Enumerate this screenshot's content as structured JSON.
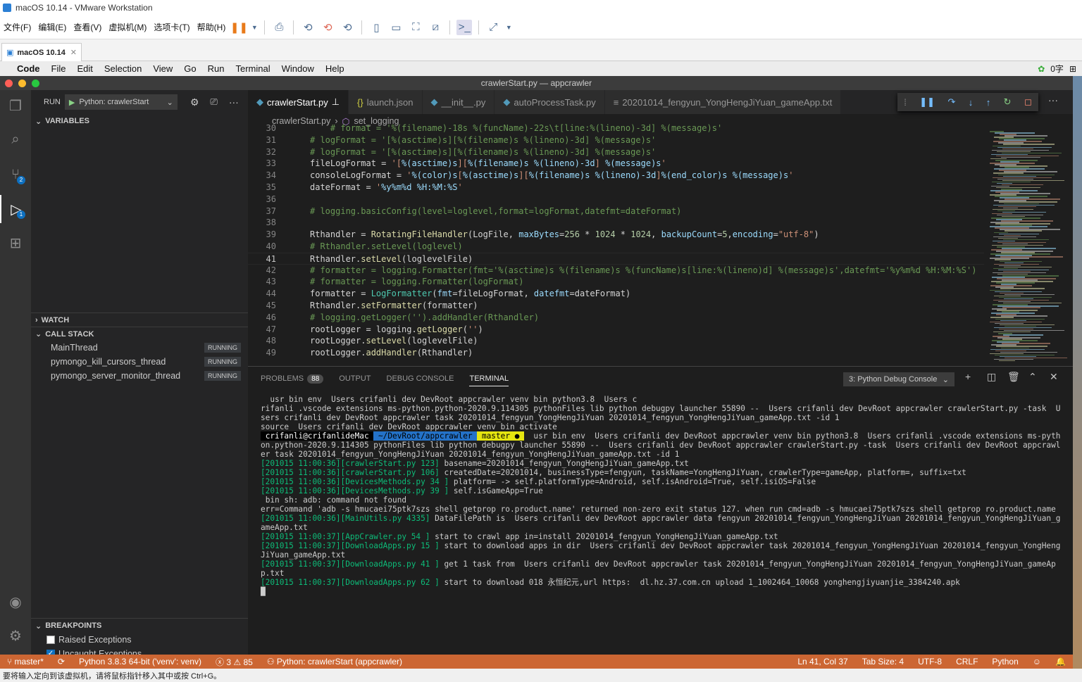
{
  "vm": {
    "title": "macOS 10.14 - VMware Workstation",
    "menu": [
      "文件(F)",
      "编辑(E)",
      "查看(V)",
      "虚拟机(M)",
      "选项卡(T)",
      "帮助(H)"
    ],
    "tab": "macOS 10.14",
    "status_hint": "要将输入定向到该虚拟机，请将鼠标指针移入其中或按 Ctrl+G。"
  },
  "mac": {
    "menu": [
      "Code",
      "File",
      "Edit",
      "Selection",
      "View",
      "Go",
      "Run",
      "Terminal",
      "Window",
      "Help"
    ],
    "right_text": "0字"
  },
  "window_title": "crawlerStart.py — appcrawler",
  "activity_badges": {
    "scm": "2",
    "debug": "1"
  },
  "sidebar": {
    "run_label": "RUN",
    "config": "Python: crawlerStart",
    "variables": "VARIABLES",
    "watch": "WATCH",
    "call_stack": "CALL STACK",
    "threads": [
      {
        "name": "MainThread",
        "state": "RUNNING"
      },
      {
        "name": "pymongo_kill_cursors_thread",
        "state": "RUNNING"
      },
      {
        "name": "pymongo_server_monitor_thread",
        "state": "RUNNING"
      }
    ],
    "breakpoints": "BREAKPOINTS",
    "bp_items": [
      {
        "label": "Raised Exceptions",
        "checked": false
      },
      {
        "label": "Uncaught Exceptions",
        "checked": true
      }
    ]
  },
  "tabs": [
    {
      "label": "crawlerStart.py",
      "icon": "python-icon",
      "active": true
    },
    {
      "label": "launch.json",
      "icon": "json-icon",
      "active": false
    },
    {
      "label": "__init__.py",
      "icon": "python-icon",
      "active": false
    },
    {
      "label": "autoProcessTask.py",
      "icon": "python-icon",
      "active": false
    },
    {
      "label": "20201014_fengyun_YongHengJiYuan_gameApp.txt",
      "icon": "text-file-icon",
      "active": false
    }
  ],
  "breadcrumb": [
    "crawlerStart.py",
    "set_logging"
  ],
  "code_lines": [
    {
      "no": "30",
      "html": "<span class='cmt'>    # format = '%(filename)-18s %(funcName)-22s\\t[line:%(lineno)-3d] %(message)s'</span>"
    },
    {
      "no": "31",
      "html": "<span class='cmt'># logFormat = '[%(asctime)s][%(filename)s %(lineno)-3d] %(message)s'</span>"
    },
    {
      "no": "32",
      "html": "<span class='cmt'># logFormat = '[%(asctime)s][%(filename)s %(lineno)-3d] %(message)s'</span>"
    },
    {
      "no": "33",
      "html": "fileLogFormat = <span class='str'>'[</span><span class='kw'>%(asctime)s</span><span class='str'>][</span><span class='kw'>%(filename)s %(lineno)-3d</span><span class='str'>] </span><span class='kw'>%(message)s</span><span class='str'>'</span>"
    },
    {
      "no": "34",
      "html": "consoleLogFormat = <span class='str'>'</span><span class='kw'>%(color)s</span><span class='str'>[</span><span class='kw'>%(asctime)s</span><span class='str'>][</span><span class='kw'>%(filename)s %(lineno)-3d</span><span class='str'>]</span><span class='kw'>%(end_color)s %(message)s</span><span class='str'>'</span>"
    },
    {
      "no": "35",
      "html": "dateFormat = <span class='str'>'</span><span class='kw'>%y%m%d %H:%M:%S</span><span class='str'>'</span>"
    },
    {
      "no": "36",
      "html": ""
    },
    {
      "no": "37",
      "html": "<span class='cmt'># logging.basicConfig(level=loglevel,format=logFormat,datefmt=dateFormat)</span>"
    },
    {
      "no": "38",
      "html": ""
    },
    {
      "no": "39",
      "html": "Rthandler = <span class='fn'>RotatingFileHandler</span>(LogFile, <span class='kw'>maxBytes</span>=<span class='num'>256</span> * <span class='num'>1024</span> * <span class='num'>1024</span>, <span class='kw'>backupCount</span>=<span class='num'>5</span>,<span class='kw'>encoding</span>=<span class='str'>\"utf-8\"</span>)"
    },
    {
      "no": "40",
      "html": "<span class='cmt'># Rthandler.setLevel(loglevel)</span>"
    },
    {
      "no": "41",
      "html": "Rthandler.<span class='fn'>setLevel</span>(loglevelFile)",
      "cur": true
    },
    {
      "no": "42",
      "html": "<span class='cmt'># formatter = logging.Formatter(fmt='%(asctime)s %(filename)s %(funcName)s[line:%(lineno)d] %(message)s',datefmt='%y%m%d %H:%M:%S')</span>"
    },
    {
      "no": "43",
      "html": "<span class='cmt'># formatter = logging.Formatter(logFormat)</span>"
    },
    {
      "no": "44",
      "html": "formatter = <span class='cls'>LogFormatter</span>(<span class='kw'>fmt</span>=fileLogFormat, <span class='kw'>datefmt</span>=dateFormat)"
    },
    {
      "no": "45",
      "html": "Rthandler.<span class='fn'>setFormatter</span>(formatter)"
    },
    {
      "no": "46",
      "html": "<span class='cmt'># logging.getLogger('').addHandler(Rthandler)</span>"
    },
    {
      "no": "47",
      "html": "rootLogger = logging.<span class='fn'>getLogger</span>(<span class='str'>''</span>)"
    },
    {
      "no": "48",
      "html": "rootLogger.<span class='fn'>setLevel</span>(loglevelFile)"
    },
    {
      "no": "49",
      "html": "rootLogger.<span class='fn'>addHandler</span>(Rthandler)"
    },
    {
      "no": "50",
      "html": ""
    }
  ],
  "panel": {
    "tabs": [
      "PROBLEMS",
      "OUTPUT",
      "DEBUG CONSOLE",
      "TERMINAL"
    ],
    "problems_count": "88",
    "active": "TERMINAL",
    "terminal_select": "3: Python Debug Console"
  },
  "terminal_html": "  usr bin env  Users crifanli dev DevRoot appcrawler venv bin python3.8  Users c\nrifanli .vscode extensions ms-python.python-2020.9.114305 pythonFiles lib python debugpy launcher 55890 --  Users crifanli dev DevRoot appcrawler crawlerStart.py -task  Users crifanli dev DevRoot appcrawler task 20201014_fengyun_YongHengJiYuan 20201014_fengyun_YongHengJiYuan_gameApp.txt -id 1\nsource  Users crifanli dev DevRoot appcrawler venv bin activate\n<span class='pbg'> crifanli@crifanlideMac </span><span class='pblue'> ~/DevRoot/appcrawler </span><span class='pyel'> master ● </span>  usr bin env  Users crifanli dev DevRoot appcrawler venv bin python3.8  Users crifanli .vscode extensions ms-python.python-2020.9.114305 pythonFiles lib python debugpy launcher 55890 --  Users crifanli dev DevRoot appcrawler crawlerStart.py -task  Users crifanli dev DevRoot appcrawler task 20201014_fengyun_YongHengJiYuan 20201014_fengyun_YongHengJiYuan_gameApp.txt -id 1\n<span class='tg'>[201015 11:00:36][crawlerStart.py 123]</span> basename=20201014_fengyun_YongHengJiYuan_gameApp.txt\n<span class='tg'>[201015 11:00:36][crawlerStart.py 106]</span> createdDate=20201014, businessType=fengyun, taskName=YongHengJiYuan, crawlerType=gameApp, platform=, suffix=txt\n<span class='tg'>[201015 11:00:36][DevicesMethods.py 34 ]</span> platform= -> self.platformType=Android, self.isAndroid=True, self.isiOS=False\n<span class='tg'>[201015 11:00:36][DevicesMethods.py 39 ]</span> self.isGameApp=True\n bin sh: adb: command not found\nerr=Command 'adb -s hmucaei75ptk7szs shell getprop ro.product.name' returned non-zero exit status 127. when run cmd=adb -s hmucaei75ptk7szs shell getprop ro.product.name\n<span class='tg'>[201015 11:00:36][MainUtils.py 4335]</span> DataFilePath is  Users crifanli dev DevRoot appcrawler data fengyun 20201014_fengyun_YongHengJiYuan 20201014_fengyun_YongHengJiYuan_gameApp.txt\n<span class='tg'>[201015 11:00:37][AppCrawler.py 54 ]</span> start to crawl app in=install 20201014_fengyun_YongHengJiYuan_gameApp.txt\n<span class='tg'>[201015 11:00:37][DownloadApps.py 15 ]</span> start to download apps in dir  Users crifanli dev DevRoot appcrawler task 20201014_fengyun_YongHengJiYuan 20201014_fengyun_YongHengJiYuan_gameApp.txt\n<span class='tg'>[201015 11:00:37][DownloadApps.py 41 ]</span> get 1 task from  Users crifanli dev DevRoot appcrawler task 20201014_fengyun_YongHengJiYuan 20201014_fengyun_YongHengJiYuan_gameApp.txt\n<span class='tg'>[201015 11:00:37][DownloadApps.py 62 ]</span> start to download 018 永恒纪元,url https:  dl.hz.37.com.cn upload 1_1002464_10068 yonghengjiyuanjie_3384240.apk\n█",
  "status": {
    "branch": "master*",
    "python": "Python 3.8.3 64-bit ('venv': venv)",
    "errors": "3",
    "warnings": "85",
    "debug": "Python: crawlerStart (appcrawler)",
    "pos": "Ln 41, Col 37",
    "tab": "Tab Size: 4",
    "enc": "UTF-8",
    "eol": "CRLF",
    "lang": "Python"
  }
}
